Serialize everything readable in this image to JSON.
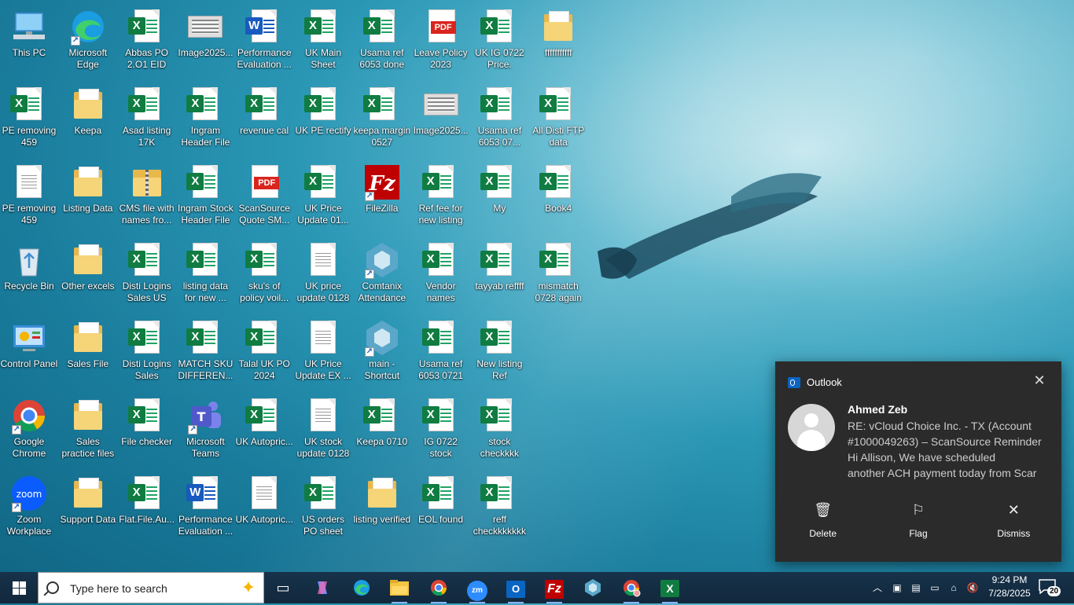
{
  "desktop": {
    "icons": [
      {
        "label": "This PC",
        "type": "pc"
      },
      {
        "label": "Microsoft Edge",
        "type": "edge"
      },
      {
        "label": "Abbas PO 2.O1 EID",
        "type": "xlsx"
      },
      {
        "label": "Image2025...",
        "type": "image"
      },
      {
        "label": "Performance Evaluation ...",
        "type": "docx"
      },
      {
        "label": "UK Main Sheet",
        "type": "xlsx"
      },
      {
        "label": "Usama ref 6053 done",
        "type": "xlsx"
      },
      {
        "label": "Leave Policy 2023",
        "type": "pdf"
      },
      {
        "label": "UK IG 0722 Price.",
        "type": "xlsx"
      },
      {
        "label": "fffffffffff",
        "type": "folder"
      },
      {
        "label": "PE removing 459",
        "type": "xlsx"
      },
      {
        "label": "Keepa",
        "type": "folder"
      },
      {
        "label": "Asad listing 17K",
        "type": "xlsx"
      },
      {
        "label": "Ingram Header File",
        "type": "xlsx"
      },
      {
        "label": "revenue cal",
        "type": "xlsx"
      },
      {
        "label": "UK PE rectify",
        "type": "xlsx"
      },
      {
        "label": "keepa margin 0527",
        "type": "xlsx"
      },
      {
        "label": "Image2025...",
        "type": "image"
      },
      {
        "label": "Usama ref 6053 07...",
        "type": "xlsx"
      },
      {
        "label": "All Disti FTP data",
        "type": "xlsx"
      },
      {
        "label": "PE removing 459",
        "type": "txt"
      },
      {
        "label": "Listing Data",
        "type": "folder"
      },
      {
        "label": "CMS file with names fro...",
        "type": "zip"
      },
      {
        "label": "Ingram Stock Header File",
        "type": "xlsx"
      },
      {
        "label": "ScanSource Quote SM...",
        "type": "pdf"
      },
      {
        "label": "UK Price Update 01...",
        "type": "xlsx"
      },
      {
        "label": "FileZilla",
        "type": "filezilla"
      },
      {
        "label": "Ref fee for new listing",
        "type": "xlsx"
      },
      {
        "label": "My",
        "type": "xlsx"
      },
      {
        "label": "Book4",
        "type": "xlsx"
      },
      {
        "label": "Recycle Bin",
        "type": "recycle"
      },
      {
        "label": "Other excels",
        "type": "folder"
      },
      {
        "label": "Disti Logins Sales US",
        "type": "xlsx"
      },
      {
        "label": "listing data for new ...",
        "type": "xlsx"
      },
      {
        "label": "sku's of policy voil...",
        "type": "xlsx"
      },
      {
        "label": "UK price update 0128",
        "type": "txt"
      },
      {
        "label": "Comtanix Attendance",
        "type": "comtanix"
      },
      {
        "label": "Vendor names",
        "type": "xlsx"
      },
      {
        "label": "tayyab reffff",
        "type": "xlsx"
      },
      {
        "label": "mismatch 0728 again",
        "type": "xlsx"
      },
      {
        "label": "Control Panel",
        "type": "control"
      },
      {
        "label": "Sales File",
        "type": "folder"
      },
      {
        "label": "Disti Logins Sales",
        "type": "xlsx"
      },
      {
        "label": "MATCH SKU DIFFEREN...",
        "type": "xlsx"
      },
      {
        "label": "Talal UK PO 2024",
        "type": "xlsx"
      },
      {
        "label": "UK Price Update EX ...",
        "type": "txt"
      },
      {
        "label": "main - Shortcut",
        "type": "comtanix"
      },
      {
        "label": "Usama ref 6053 0721",
        "type": "xlsx"
      },
      {
        "label": "New listing Ref",
        "type": "xlsx"
      },
      {
        "label": "Google Chrome",
        "type": "chrome"
      },
      {
        "label": "Sales practice files",
        "type": "folder"
      },
      {
        "label": "File checker",
        "type": "xlsx"
      },
      {
        "label": "Microsoft Teams",
        "type": "teams"
      },
      {
        "label": "UK Autopric...",
        "type": "xlsx"
      },
      {
        "label": "UK stock update 0128",
        "type": "txt"
      },
      {
        "label": "Keepa 0710",
        "type": "xlsx"
      },
      {
        "label": "IG 0722 stock",
        "type": "xlsx"
      },
      {
        "label": "stock checkkkk",
        "type": "xlsx"
      },
      {
        "label": "Zoom Workplace",
        "type": "zoom"
      },
      {
        "label": "Support Data",
        "type": "folder"
      },
      {
        "label": "Flat.File.Au...",
        "type": "xlsx"
      },
      {
        "label": "Performance Evaluation ...",
        "type": "docx"
      },
      {
        "label": "UK Autopric...",
        "type": "txt"
      },
      {
        "label": "US orders PO sheet",
        "type": "xlsx"
      },
      {
        "label": "listing verified",
        "type": "folder"
      },
      {
        "label": "EOL found",
        "type": "xlsx"
      },
      {
        "label": "reff checkkkkkkk",
        "type": "xlsx"
      }
    ]
  },
  "notification": {
    "app": "Outlook",
    "sender": "Ahmed Zeb",
    "line1": "RE: vCloud Choice Inc. - TX (Account",
    "line2": "#1000049263) – ScanSource Reminder",
    "line3": "Hi Allison,  We have scheduled",
    "line4": "another ACH payment today from Scar",
    "actions": {
      "delete": "Delete",
      "flag": "Flag",
      "dismiss": "Dismiss"
    }
  },
  "taskbar": {
    "search_placeholder": "Type here to search",
    "time": "9:24 PM",
    "date": "7/28/2025",
    "notification_count": "20"
  }
}
